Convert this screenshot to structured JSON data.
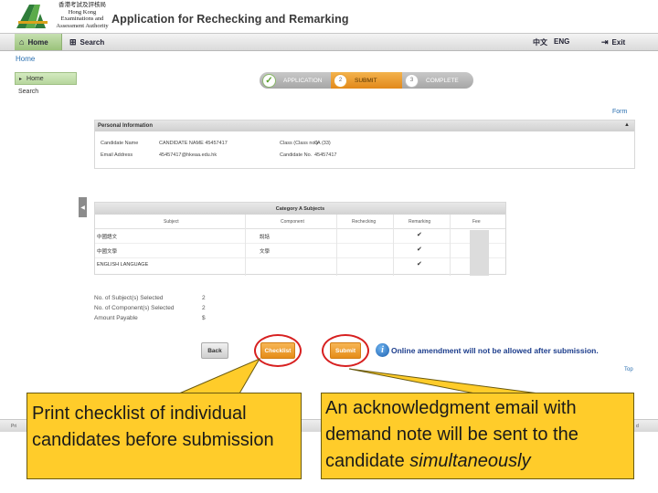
{
  "header": {
    "org_name_zh": "香港考試及評核局",
    "org_name_en": "Hong Kong Examinations and Assessment Authority",
    "title": "Application for Rechecking and Remarking"
  },
  "nav": {
    "home": "Home",
    "search": "Search",
    "lang_zh": "中文",
    "lang_en": "ENG",
    "exit": "Exit"
  },
  "breadcrumb": {
    "home": "Home"
  },
  "sidebar": {
    "items": [
      {
        "label": "Home",
        "active": true
      },
      {
        "label": "Search",
        "active": false
      }
    ]
  },
  "steps": [
    {
      "num": "",
      "label": "APPLICATION",
      "state": "done"
    },
    {
      "num": "2",
      "label": "SUBMIT",
      "state": "current"
    },
    {
      "num": "3",
      "label": "COMPLETE",
      "state": "pending"
    }
  ],
  "form_link": "Form",
  "personal": {
    "heading": "Personal Information",
    "collapse": "▲",
    "candidate_name_label": "Candidate Name",
    "candidate_name_value": "CANDIDATE NAME 45457417",
    "class_label": "Class (Class no.)",
    "class_value": "6A (33)",
    "email_label": "Email Address",
    "email_value": "45457417@hkeaa.edu.hk",
    "candidate_no_label": "Candidate No.",
    "candidate_no_value": "45457417"
  },
  "subjects": {
    "title": "Category A Subjects",
    "columns": [
      "Subject",
      "Component",
      "Rechecking",
      "Remarking",
      "Fee"
    ],
    "rows": [
      {
        "subject": "中國語文",
        "component": "說話",
        "rechecking": "",
        "remarking": "✔"
      },
      {
        "subject": "中國文學",
        "component": "文學",
        "rechecking": "",
        "remarking": "✔"
      },
      {
        "subject": "ENGLISH LANGUAGE",
        "component": "",
        "rechecking": "",
        "remarking": "✔"
      }
    ]
  },
  "summary": [
    {
      "label": "No. of Subject(s) Selected",
      "value": "2"
    },
    {
      "label": "No. of Component(s) Selected",
      "value": "2"
    },
    {
      "label": "Amount Payable",
      "value": "$"
    }
  ],
  "buttons": {
    "back": "Back",
    "checklist": "Checklist",
    "submit": "Submit"
  },
  "notice": "Online amendment will not be allowed after submission.",
  "top_link": "Top",
  "footer": {
    "left": "Pri",
    "right": "d"
  },
  "callouts": {
    "checklist_text": "Print checklist of individual candidates before submission",
    "submit_text_main": "An acknowledgment email with demand note will be sent to the candidate ",
    "submit_text_em": "simultaneously"
  },
  "colors": {
    "accent_orange": "#e58c18",
    "nav_green": "#9ac27a",
    "callout_yellow": "#ffcc2a",
    "ring_red": "#d72020",
    "notice_blue": "#1c3d8c"
  }
}
